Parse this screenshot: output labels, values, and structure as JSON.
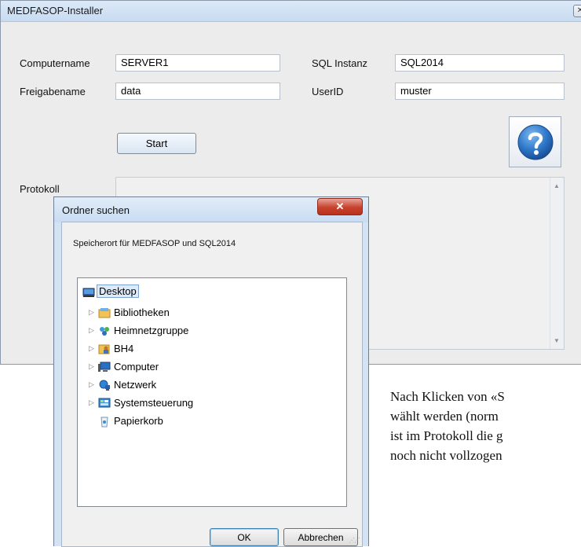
{
  "main_window": {
    "title": "MEDFASOP-Installer",
    "close_glyph": "✕",
    "labels": {
      "computername": "Computername",
      "freigabename": "Freigabename",
      "sql_instanz": "SQL Instanz",
      "userid": "UserID",
      "protokoll": "Protokoll"
    },
    "fields": {
      "computername": "SERVER1",
      "freigabename": "data",
      "sql_instanz": "SQL2014",
      "userid": "muster"
    },
    "start_label": "Start",
    "help_icon": "question-mark-icon"
  },
  "dialog": {
    "title": "Ordner suchen",
    "close_glyph": "✕",
    "description": "Speicherort für MEDFASOP und SQL2014",
    "tree": [
      {
        "label": "Desktop",
        "icon": "desktop-icon"
      },
      {
        "label": "Bibliotheken",
        "icon": "libraries-icon"
      },
      {
        "label": "Heimnetzgruppe",
        "icon": "homegroup-icon"
      },
      {
        "label": "BH4",
        "icon": "user-folder-icon"
      },
      {
        "label": "Computer",
        "icon": "computer-icon"
      },
      {
        "label": "Netzwerk",
        "icon": "network-icon"
      },
      {
        "label": "Systemsteuerung",
        "icon": "control-panel-icon"
      },
      {
        "label": "Papierkorb",
        "icon": "recycle-bin-icon"
      }
    ],
    "ok_label": "OK",
    "cancel_label": "Abbrechen"
  },
  "document": {
    "lines": [
      "Nach Klicken von «S",
      "wählt werden (norm",
      "ist im Protokoll die g",
      "noch nicht vollzogen"
    ]
  }
}
